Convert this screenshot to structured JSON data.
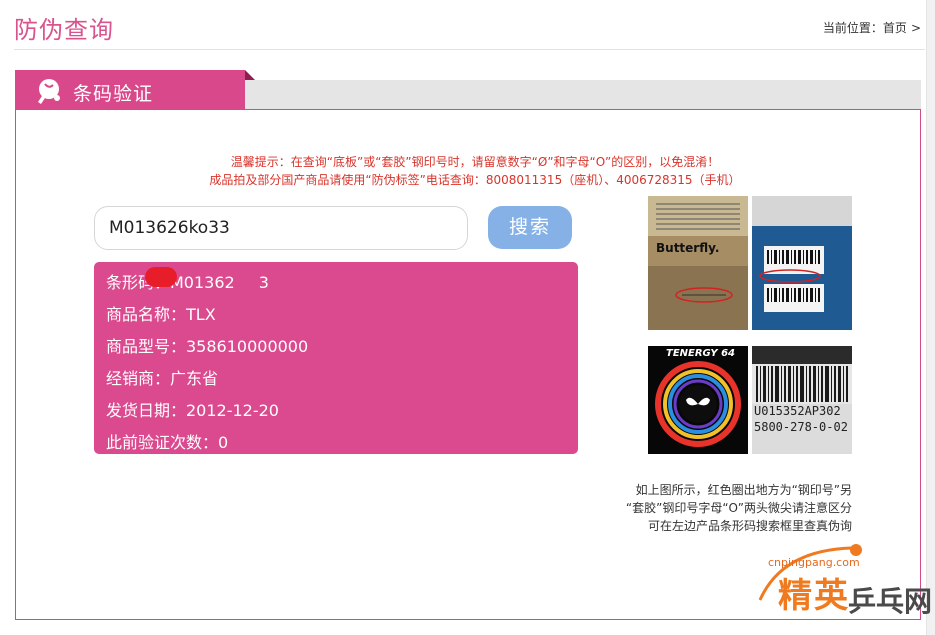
{
  "header": {
    "title": "防伪查询",
    "breadcrumb_prefix": "当前位置：",
    "breadcrumb_home": "首页",
    "breadcrumb_sep": ">"
  },
  "tab": {
    "label": "条码验证",
    "icon": "ping-pong-icon"
  },
  "notice": {
    "line1": "温馨提示：在查询“底板”或“套胶”钢印号时，请留意数字“Ø”和字母“O”的区别，以免混淆！",
    "line2": "成品拍及部分国产商品请使用“防伪标签”电话查询：8008011315（座机）、4006728315（手机）"
  },
  "search": {
    "value": "M013626ko33",
    "button_label": "搜索"
  },
  "result": {
    "barcode": "条形码：M01362",
    "barcode_tail": "3",
    "product_name": "商品名称：TLX",
    "product_model": "商品型号：358610000000",
    "dealer": "经销商：广东省",
    "ship_date": "发货日期：2012-12-20",
    "verify_count": "此前验证次数：0"
  },
  "images": {
    "img1_brand": "Butterfly.",
    "img3_brand": "TENERGY 64",
    "img4_code1": "U015352AP302",
    "img4_code2": "5800-278-0-02"
  },
  "caption": {
    "line1": "如上图所示，红色圈出地方为“钢印号”另",
    "line2": "“套胶”钢印号字母“O”两头微尖请注意区分",
    "line3": "可在左边产品条形码搜索框里查真伪询"
  },
  "watermark": {
    "url": "cnpingpang.com",
    "brand_a": "精英",
    "brand_b": "乒乓网"
  },
  "colors": {
    "brand_pink": "#d9488a",
    "search_button": "#86b1e6",
    "notice_red": "#d9342b"
  }
}
